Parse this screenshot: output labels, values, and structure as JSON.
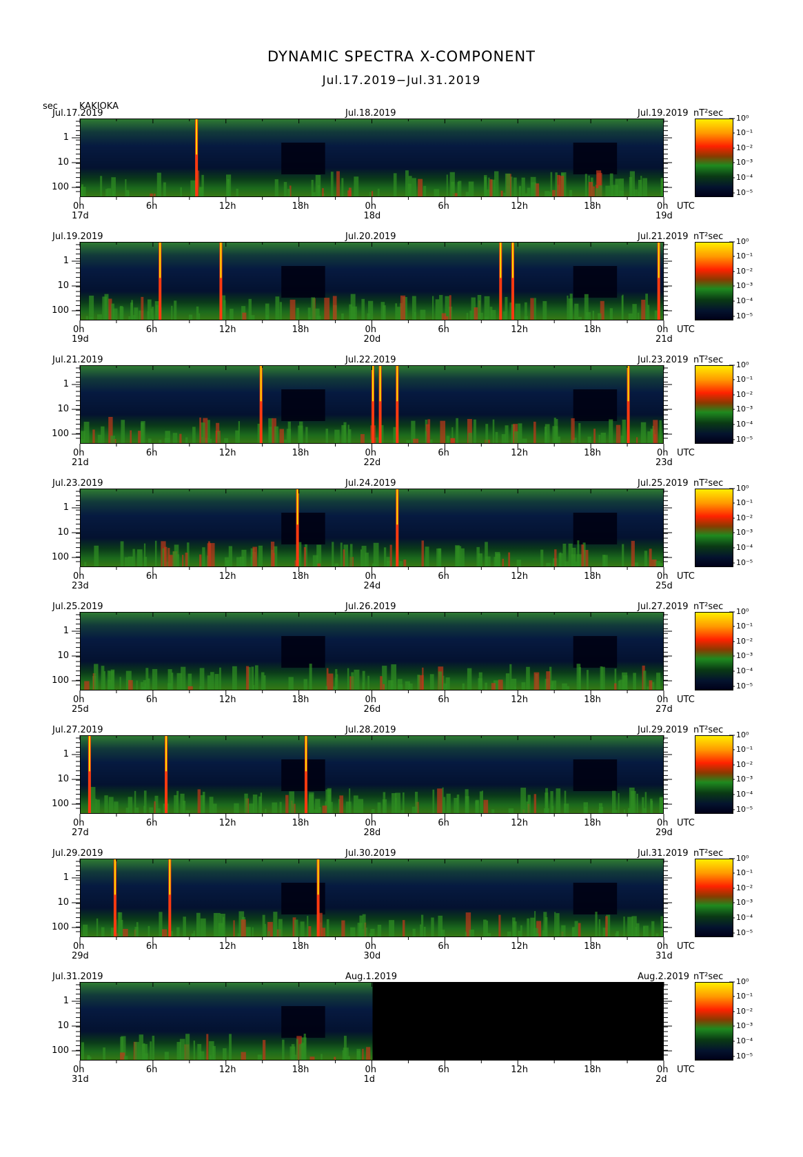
{
  "title": "DYNAMIC SPECTRA X-COMPONENT",
  "date_range": "Jul.17.2019−Jul.31.2019",
  "y_unit": "sec",
  "station": "KAKIOKA",
  "colorbar_unit": "nT²sec",
  "utc_label": "UTC",
  "colors": {
    "low": "#000018",
    "mid": "#1f8a1f",
    "high": "#ff2200",
    "max": "#ffee00"
  },
  "chart_data": {
    "type": "heatmap",
    "xlabel": "UTC",
    "ylabel": "sec",
    "y_scale": "log",
    "y_ticks": [
      "1",
      "10",
      "100"
    ],
    "x_ticks": [
      "0h",
      "6h",
      "12h",
      "18h",
      "0h",
      "6h",
      "12h",
      "18h",
      "0h"
    ],
    "colorbar_ticks": [
      "10⁰",
      "10⁻¹",
      "10⁻²",
      "10⁻³",
      "10⁻⁴",
      "10⁻⁵"
    ],
    "panels": [
      {
        "start_date": "Jul.17.2019",
        "mid_date": "Jul.18.2019",
        "end_date": "Jul.19.2019",
        "day_labels": [
          "17d",
          "18d",
          "19d"
        ],
        "events_hours": [
          9.5
        ],
        "no_data_from_hour": null
      },
      {
        "start_date": "Jul.19.2019",
        "mid_date": "Jul.20.2019",
        "end_date": "Jul.21.2019",
        "day_labels": [
          "19d",
          "20d",
          "21d"
        ],
        "events_hours": [
          6.5,
          11.5,
          34.5,
          35.5,
          47.5
        ],
        "no_data_from_hour": null
      },
      {
        "start_date": "Jul.21.2019",
        "mid_date": "Jul.22.2019",
        "end_date": "Jul.23.2019",
        "day_labels": [
          "21d",
          "22d",
          "23d"
        ],
        "events_hours": [
          14.8,
          24,
          24.6,
          26,
          45
        ],
        "no_data_from_hour": null
      },
      {
        "start_date": "Jul.23.2019",
        "mid_date": "Jul.24.2019",
        "end_date": "Jul.25.2019",
        "day_labels": [
          "23d",
          "24d",
          "25d"
        ],
        "events_hours": [
          17.8,
          26
        ],
        "no_data_from_hour": null
      },
      {
        "start_date": "Jul.25.2019",
        "mid_date": "Jul.26.2019",
        "end_date": "Jul.27.2019",
        "day_labels": [
          "25d",
          "26d",
          "27d"
        ],
        "events_hours": [],
        "no_data_from_hour": null
      },
      {
        "start_date": "Jul.27.2019",
        "mid_date": "Jul.28.2019",
        "end_date": "Jul.29.2019",
        "day_labels": [
          "27d",
          "28d",
          "29d"
        ],
        "events_hours": [
          0.7,
          7,
          18.5
        ],
        "no_data_from_hour": null
      },
      {
        "start_date": "Jul.29.2019",
        "mid_date": "Jul.30.2019",
        "end_date": "Jul.31.2019",
        "day_labels": [
          "29d",
          "30d",
          "31d"
        ],
        "events_hours": [
          2.8,
          7.3,
          19.5
        ],
        "no_data_from_hour": null
      },
      {
        "start_date": "Jul.31.2019",
        "mid_date": "Aug.1.2019",
        "end_date": "Aug.2.2019",
        "day_labels": [
          "31d",
          "1d",
          "2d"
        ],
        "events_hours": [],
        "no_data_from_hour": 24
      }
    ]
  }
}
